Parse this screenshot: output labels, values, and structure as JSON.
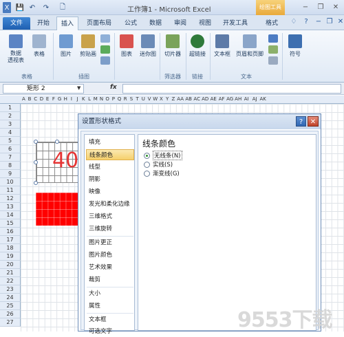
{
  "window": {
    "title": "工作簿1 - Microsoft Excel",
    "context_tab": "绘图工具",
    "controls": {
      "help": "?",
      "minimize": "−",
      "restore": "❐",
      "close": "✕"
    }
  },
  "quick_access": {
    "save_icon": "💾",
    "undo_icon": "↶",
    "redo_icon": "↷",
    "preview_icon": "🗋"
  },
  "tabs": [
    "文件",
    "开始",
    "插入",
    "页面布局",
    "公式",
    "数据",
    "审阅",
    "视图",
    "开发工具",
    "格式"
  ],
  "ribbon": {
    "buttons": [
      {
        "label": "数据\n透视表",
        "icon": "pivot-table-icon",
        "color": "#5b84c4"
      },
      {
        "label": "表格",
        "icon": "table-icon",
        "color": "#9fb4cf"
      },
      {
        "label": "图片",
        "icon": "picture-icon",
        "color": "#6f9bd1"
      },
      {
        "label": "剪贴画",
        "icon": "clipart-icon",
        "color": "#c9a24b"
      },
      {
        "label": "图表",
        "icon": "chart-icon",
        "color": "#d9534f"
      },
      {
        "label": "迷你图",
        "icon": "sparkline-icon",
        "color": "#6b8bb7"
      },
      {
        "label": "切片器",
        "icon": "slicer-icon",
        "color": "#7aa35a"
      },
      {
        "label": "超链接",
        "icon": "hyperlink-icon",
        "color": "#2f7a3a"
      },
      {
        "label": "文本框",
        "icon": "textbox-icon",
        "color": "#5d7ba8"
      },
      {
        "label": "页眉和页脚",
        "icon": "header-footer-icon",
        "color": "#8aa5c9"
      },
      {
        "label": "符号",
        "icon": "symbol-icon",
        "color": "#3d6fb0"
      }
    ],
    "groups": [
      "表格",
      "插图",
      "筛选器",
      "链接",
      "文本"
    ]
  },
  "formula_bar": {
    "name_box": "矩形 2",
    "fx": "fx",
    "formula": ""
  },
  "sheet": {
    "columns": [
      "A",
      "B",
      "C",
      "D",
      "E",
      "F",
      "G",
      "H",
      "I",
      "J",
      "K",
      "L",
      "M",
      "N",
      "O",
      "P",
      "Q",
      "R",
      "S",
      "T",
      "U",
      "V",
      "W",
      "X",
      "Y",
      "Z",
      "AA",
      "AB",
      "AC",
      "AD",
      "AE",
      "AF",
      "AG",
      "AH",
      "AI",
      "AJ",
      "AK"
    ],
    "rows": [
      "1",
      "2",
      "3",
      "4",
      "5",
      "6",
      "7",
      "8",
      "9",
      "10",
      "11",
      "12",
      "13",
      "14",
      "15",
      "16",
      "17",
      "18",
      "19",
      "20",
      "21",
      "22",
      "23",
      "24",
      "25",
      "26",
      "27"
    ],
    "shape_text": "40",
    "red_color": "#ff0000"
  },
  "dialog": {
    "title": "设置形状格式",
    "help_label": "?",
    "close_label": "✕",
    "nav": [
      "填充",
      "线条颜色",
      "线型",
      "阴影",
      "映像",
      "发光和柔化边缘",
      "三维格式",
      "三维旋转",
      "图片更正",
      "图片颜色",
      "艺术效果",
      "裁剪",
      "大小",
      "属性",
      "文本框",
      "可选文字"
    ],
    "selected_nav": "线条颜色",
    "panel_title": "线条颜色",
    "options": [
      {
        "label": "无线条(N)",
        "checked": true
      },
      {
        "label": "实线(S)",
        "checked": false
      },
      {
        "label": "渐变线(G)",
        "checked": false
      }
    ]
  },
  "watermark": "9553下载"
}
